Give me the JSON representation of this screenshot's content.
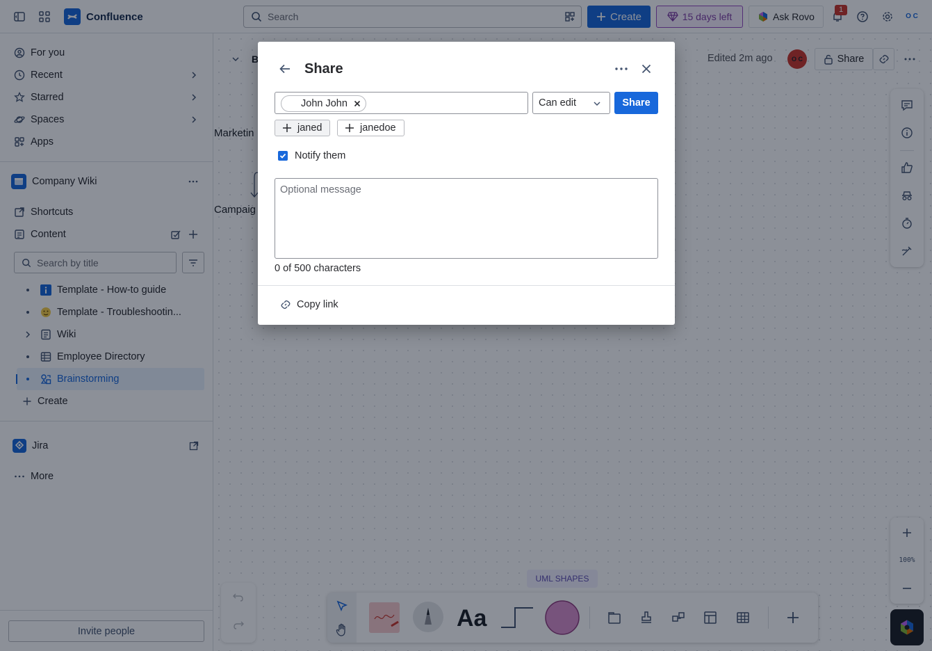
{
  "topnav": {
    "app_name": "Confluence",
    "search_placeholder": "Search",
    "create_label": "Create",
    "trial_label": "15 days left",
    "rovo_label": "Ask Rovo",
    "notification_count": "1",
    "profile_initials": "O C"
  },
  "sidebar": {
    "nav": [
      {
        "label": "For you",
        "icon": "user-circle-icon"
      },
      {
        "label": "Recent",
        "icon": "clock-icon"
      },
      {
        "label": "Starred",
        "icon": "star-icon"
      },
      {
        "label": "Spaces",
        "icon": "planet-icon"
      },
      {
        "label": "Apps",
        "icon": "apps-icon"
      }
    ],
    "space_name": "Company Wiki",
    "shortcuts_label": "Shortcuts",
    "content_label": "Content",
    "search_placeholder": "Search by title",
    "tree": [
      {
        "label": "Template - How-to guide",
        "icon": "info-icon"
      },
      {
        "label": "Template - Troubleshootin...",
        "icon": "emoji-icon"
      },
      {
        "label": "Wiki",
        "icon": "page-icon"
      },
      {
        "label": "Employee Directory",
        "icon": "database-icon"
      },
      {
        "label": "Brainstorming",
        "icon": "whiteboard-icon"
      }
    ],
    "create_label": "Create",
    "jira_label": "Jira",
    "more_label": "More",
    "invite_label": "Invite people"
  },
  "page": {
    "title_fragment": "B",
    "edited_label": "Edited 2m ago",
    "avatar_initials": "O C",
    "share_label": "Share",
    "canvas_labels": [
      "Marketin",
      "Campaig"
    ],
    "zoom_level": "100%",
    "uml_label": "UML SHAPES"
  },
  "share_dialog": {
    "title": "Share",
    "chip_name": "John John",
    "permission": "Can edit",
    "share_button": "Share",
    "suggestions": [
      "janed",
      "janedoe"
    ],
    "notify_label": "Notify them",
    "notify_checked": true,
    "message_placeholder": "Optional message",
    "char_count": "0 of 500 characters",
    "copy_link_label": "Copy link"
  },
  "colors": {
    "brand_blue": "#1868db",
    "trial_purple": "#803fa5",
    "overlay": "#050c1f"
  }
}
